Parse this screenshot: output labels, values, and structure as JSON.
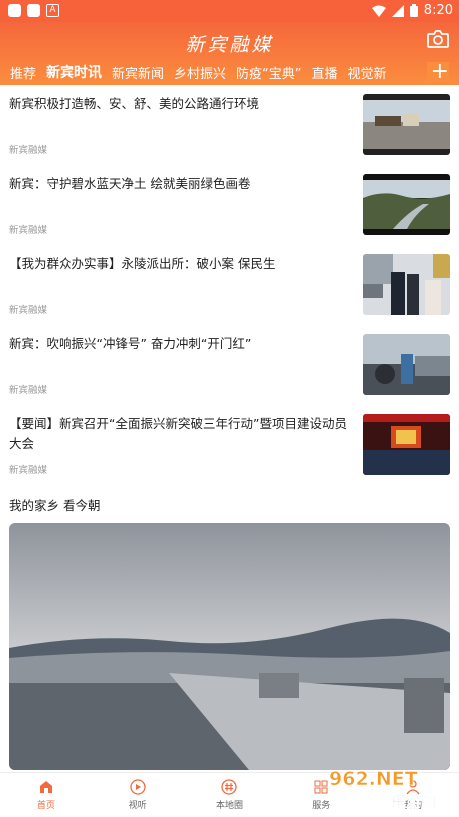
{
  "status_bar": {
    "time": "8:20"
  },
  "header": {
    "logo": "新宾融媒"
  },
  "tabs": [
    "推荐",
    "新宾时讯",
    "新宾新闻",
    "乡村振兴",
    "防疫“宝典”",
    "直播",
    "视觉新"
  ],
  "active_tab": 1,
  "news": [
    {
      "title": "新宾积极打造畅、安、舒、美的公路通行环境",
      "source": "新宾融媒"
    },
    {
      "title": "新宾：守护碧水蓝天净土  绘就美丽绿色画卷",
      "source": "新宾融媒"
    },
    {
      "title": "【我为群众办实事】永陵派出所：破小案 保民生",
      "source": "新宾融媒"
    },
    {
      "title": "新宾：吹响振兴“冲锋号” 奋力冲刺“开门红”",
      "source": "新宾融媒"
    },
    {
      "title": "【要闻】新宾召开“全面振兴新突破三年行动”暨项目建设动员大会",
      "source": "新宾融媒"
    }
  ],
  "section_title": "我的家乡 看今朝",
  "bottom_nav": [
    {
      "label": "首页",
      "icon": "home-icon"
    },
    {
      "label": "视听",
      "icon": "play-icon"
    },
    {
      "label": "本地圈",
      "icon": "hash-icon"
    },
    {
      "label": "服务",
      "icon": "grid-icon"
    },
    {
      "label": "我的",
      "icon": "user-icon"
    }
  ],
  "watermark": {
    "line1": "962.NET",
    "line2": "乐游网"
  },
  "colors": {
    "accent": "#f7623a",
    "accent_light": "#fb8d3f"
  }
}
